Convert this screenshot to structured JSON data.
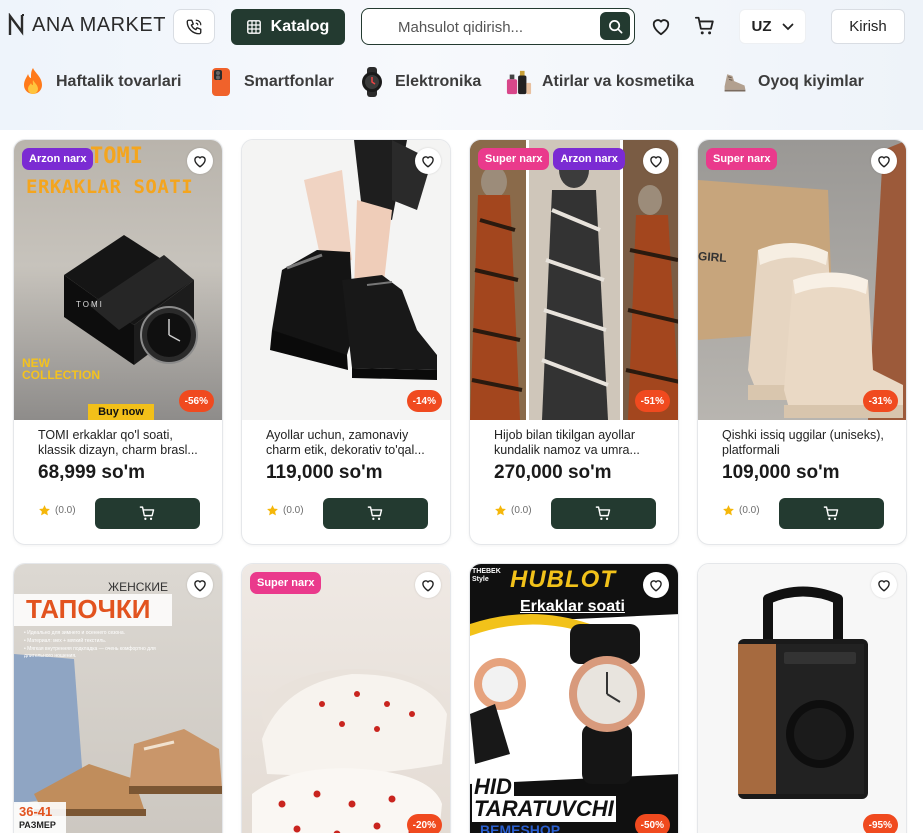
{
  "header": {
    "logo_text": "ANA MARKET",
    "katalog_label": "Katalog",
    "search_placeholder": "Mahsulot qidirish...",
    "language": "UZ",
    "login_label": "Kirish"
  },
  "categories": [
    {
      "label": "Haftalik tovarlari",
      "icon": "fire-icon"
    },
    {
      "label": "Smartfonlar",
      "icon": "smartphone-icon"
    },
    {
      "label": "Elektronika",
      "icon": "smartwatch-icon"
    },
    {
      "label": "Atirlar va kosmetika",
      "icon": "perfume-icon"
    },
    {
      "label": "Oyoq kiyimlar",
      "icon": "shoe-icon"
    }
  ],
  "products": [
    {
      "badges": [
        "Arzon narx"
      ],
      "discount": "-56%",
      "title": "TOMI erkaklar qo'l soati, klassik dizayn, charm brasl...",
      "price": "68,999 so'm",
      "rating": "(0.0)",
      "image_text": {
        "line1": "TOMI",
        "line2": "ERKAKLAR SOATI",
        "promo1": "NEW",
        "promo2": "COLLECTION",
        "cta": "Buy now",
        "brand": "TOMI"
      }
    },
    {
      "badges": [],
      "discount": "-14%",
      "title": "Ayollar uchun, zamonaviy charm etik, dekorativ to'qal...",
      "price": "119,000 so'm",
      "rating": "(0.0)"
    },
    {
      "badges": [
        "Super narx",
        "Arzon narx"
      ],
      "discount": "-51%",
      "title": "Hijob bilan tikilgan ayollar kundalik namoz va umra...",
      "price": "270,000 so'm",
      "rating": "(0.0)"
    },
    {
      "badges": [
        "Super narx"
      ],
      "discount": "-31%",
      "title": "Qishki issiq uggilar (uniseks), platformali",
      "price": "109,000 so'm",
      "rating": "(0.0)",
      "image_text": {
        "bag": "GIRL"
      }
    },
    {
      "badges": [],
      "discount": "",
      "image_text": {
        "top": "ЖЕНСКИЕ",
        "big": "ТАПОЧКИ",
        "size1": "36-41",
        "size2": "РАЗМЕР",
        "bullets": [
          "• Идеально для зимнего и осеннего сезона.",
          "• Материал: мех + мягкий текстиль.",
          "• Мягкая внутренняя подкладка — очень комфортно для длительного ношения."
        ]
      }
    },
    {
      "badges": [
        "Super narx"
      ],
      "discount": "-20%"
    },
    {
      "badges": [],
      "discount": "-50%",
      "image_text": {
        "brand": "HUBLOT",
        "sub": "Erkaklar soati",
        "bottom1": "HID",
        "bottom2": "TARATUVCHI",
        "corner": "THEBEK Style",
        "bottom3": "BEMESHOP"
      }
    },
    {
      "badges": [],
      "discount": "-95%"
    }
  ],
  "colors": {
    "primary": "#233a30",
    "discount": "#f04a1f",
    "badge_purple": "#7b2bd3",
    "badge_pink": "#ea3a8c"
  }
}
